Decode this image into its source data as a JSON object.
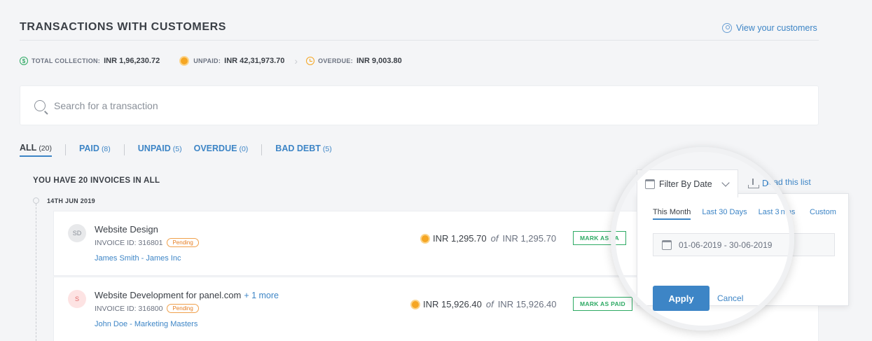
{
  "header": {
    "title": "TRANSACTIONS WITH CUSTOMERS",
    "view_customers": "View your customers"
  },
  "stats": {
    "total_label": "TOTAL COLLECTION:",
    "total_value": "INR 1,96,230.72",
    "unpaid_label": "UNPAID:",
    "unpaid_value": "INR 42,31,973.70",
    "overdue_label": "OVERDUE:",
    "overdue_value": "INR 9,003.80"
  },
  "search": {
    "placeholder": "Search for a transaction"
  },
  "tabs": [
    {
      "label": "ALL",
      "count": "(20)"
    },
    {
      "label": "PAID",
      "count": "(8)"
    },
    {
      "label": "UNPAID",
      "count": "(5)"
    },
    {
      "label": "OVERDUE",
      "count": "(0)"
    },
    {
      "label": "BAD DEBT",
      "count": "(5)"
    }
  ],
  "list": {
    "heading": "YOU HAVE 20 INVOICES IN ALL",
    "download": "load this list",
    "date_group": "14TH JUN 2019"
  },
  "invoices": [
    {
      "initials": "SD",
      "title": "Website Design",
      "more": "",
      "invoice_id": "INVOICE ID: 316801",
      "status": "Pending",
      "customer": "James Smith - James Inc",
      "amount": "INR 1,295.70",
      "of": "of",
      "total": "INR 1,295.70",
      "action": "MARK AS PA"
    },
    {
      "initials": "S",
      "title": "Website Development for panel.com",
      "more": "+ 1 more",
      "invoice_id": "INVOICE ID: 316800",
      "status": "Pending",
      "customer": "John Doe - Marketing Masters",
      "amount": "INR 15,926.40",
      "of": "of",
      "total": "INR 15,926.40",
      "action": "MARK AS PAID"
    }
  ],
  "filter": {
    "button_label": "Filter By Date",
    "download_partial": "D",
    "tabs": [
      "This Month",
      "Last 30 Days",
      "Last 3"
    ],
    "tab_partial": "nths",
    "custom": "Custom",
    "date_range": "01-06-2019 - 30-06-2019",
    "apply": "Apply",
    "cancel": "Cancel"
  },
  "colors": {
    "accent": "#3d85c6",
    "paid_green": "#2eaa64",
    "pending_orange": "#f5a623"
  }
}
